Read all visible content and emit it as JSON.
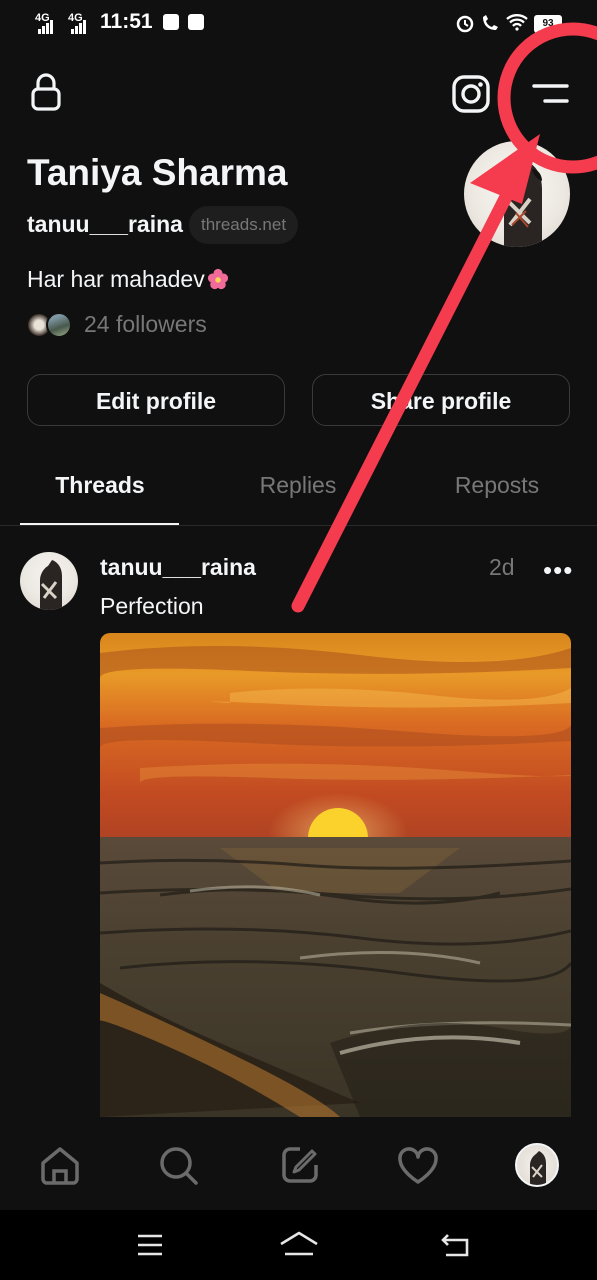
{
  "status_bar": {
    "network_1": "4G",
    "network_2": "4G",
    "time": "11:51",
    "battery": "93"
  },
  "header": {
    "lock_icon": "lock-icon",
    "instagram_icon": "instagram-icon",
    "menu_icon": "menu-icon"
  },
  "profile": {
    "name": "Taniya Sharma",
    "handle": "tanuu___raina",
    "domain_badge": "threads.net",
    "bio": "Har har mahadev",
    "bio_emoji": "flower-icon",
    "followers": "24 followers"
  },
  "buttons": {
    "edit": "Edit profile",
    "share": "Share profile"
  },
  "tabs": [
    {
      "label": "Threads",
      "active": true
    },
    {
      "label": "Replies",
      "active": false
    },
    {
      "label": "Reposts",
      "active": false
    }
  ],
  "post": {
    "username": "tanuu___raina",
    "time": "2d",
    "more": "•••",
    "text": "Perfection",
    "image": "sunset-over-sea"
  },
  "bottom_nav": [
    "home-icon",
    "search-icon",
    "compose-icon",
    "heart-icon",
    "profile-avatar"
  ],
  "system_nav": [
    "menu-icon",
    "home-icon",
    "back-icon"
  ],
  "colors": {
    "background": "#101010",
    "text": "#f3f5f7",
    "muted": "#777777",
    "annotation": "#f53b4e"
  }
}
